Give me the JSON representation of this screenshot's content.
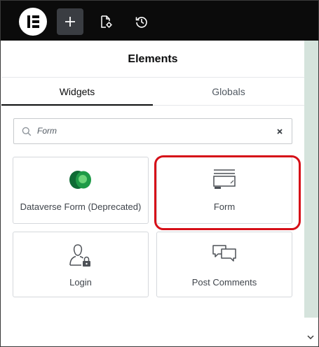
{
  "app": {
    "toolbar": {
      "logo_icon": "elementor-logo-icon",
      "add_icon": "plus-icon",
      "page_settings_icon": "page-settings-icon",
      "history_icon": "history-icon"
    }
  },
  "panel": {
    "title": "Elements",
    "tabs": [
      {
        "label": "Widgets",
        "active": true
      },
      {
        "label": "Globals",
        "active": false
      }
    ],
    "search": {
      "value": "Form",
      "icon": "search-icon",
      "clear_icon": "close-icon"
    },
    "widgets": [
      {
        "label": "Dataverse Form (Deprecated)",
        "icon": "dataverse-logo-icon"
      },
      {
        "label": "Form",
        "icon": "form-icon",
        "highlighted": true
      },
      {
        "label": "Login",
        "icon": "login-user-lock-icon"
      },
      {
        "label": "Post Comments",
        "icon": "comments-icon"
      }
    ]
  },
  "colors": {
    "toolbar_bg": "#0b0b0b",
    "highlight": "#d60f18",
    "scroll_track": "#d5e3dc",
    "dataverse_dark": "#0f6b35",
    "dataverse_light": "#6cd47a"
  }
}
